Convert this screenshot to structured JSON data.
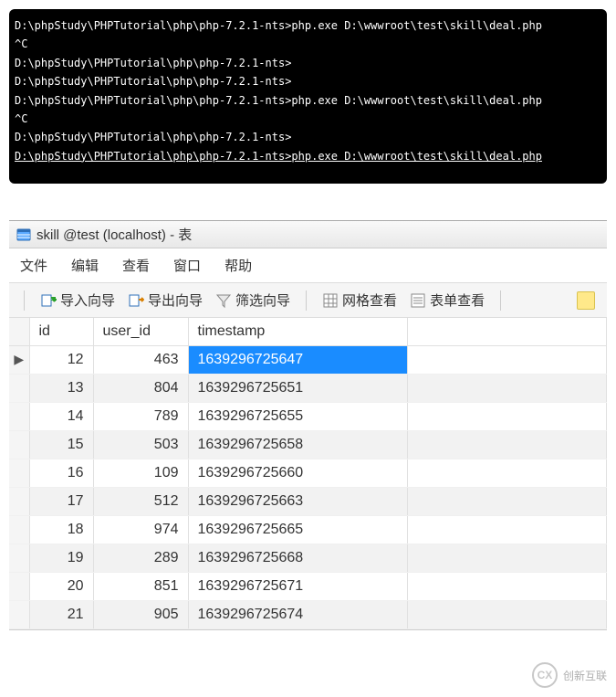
{
  "terminal": {
    "lines": [
      {
        "text": "D:\\phpStudy\\PHPTutorial\\php\\php-7.2.1-nts>php.exe D:\\wwwroot\\test\\skill\\deal.php",
        "underline": false
      },
      {
        "text": "^C",
        "underline": false
      },
      {
        "text": "D:\\phpStudy\\PHPTutorial\\php\\php-7.2.1-nts>",
        "underline": false
      },
      {
        "text": "D:\\phpStudy\\PHPTutorial\\php\\php-7.2.1-nts>",
        "underline": false
      },
      {
        "text": "D:\\phpStudy\\PHPTutorial\\php\\php-7.2.1-nts>php.exe D:\\wwwroot\\test\\skill\\deal.php",
        "underline": false
      },
      {
        "text": "^C",
        "underline": false
      },
      {
        "text": "D:\\phpStudy\\PHPTutorial\\php\\php-7.2.1-nts>",
        "underline": false
      },
      {
        "text": "D:\\phpStudy\\PHPTutorial\\php\\php-7.2.1-nts>php.exe D:\\wwwroot\\test\\skill\\deal.php",
        "underline": true
      }
    ]
  },
  "db": {
    "title": "skill @test (localhost) - 表",
    "menu": {
      "file": "文件",
      "edit": "编辑",
      "view": "查看",
      "window": "窗口",
      "help": "帮助"
    },
    "toolbar": {
      "import": "导入向导",
      "export": "导出向导",
      "filter": "筛选向导",
      "grid_view": "网格查看",
      "form_view": "表单查看"
    },
    "columns": {
      "id": "id",
      "user_id": "user_id",
      "timestamp": "timestamp"
    },
    "rows": [
      {
        "id": 12,
        "user_id": 463,
        "timestamp": "1639296725647",
        "selected": true,
        "current": true
      },
      {
        "id": 13,
        "user_id": 804,
        "timestamp": "1639296725651",
        "selected": false,
        "current": false
      },
      {
        "id": 14,
        "user_id": 789,
        "timestamp": "1639296725655",
        "selected": false,
        "current": false
      },
      {
        "id": 15,
        "user_id": 503,
        "timestamp": "1639296725658",
        "selected": false,
        "current": false
      },
      {
        "id": 16,
        "user_id": 109,
        "timestamp": "1639296725660",
        "selected": false,
        "current": false
      },
      {
        "id": 17,
        "user_id": 512,
        "timestamp": "1639296725663",
        "selected": false,
        "current": false
      },
      {
        "id": 18,
        "user_id": 974,
        "timestamp": "1639296725665",
        "selected": false,
        "current": false
      },
      {
        "id": 19,
        "user_id": 289,
        "timestamp": "1639296725668",
        "selected": false,
        "current": false
      },
      {
        "id": 20,
        "user_id": 851,
        "timestamp": "1639296725671",
        "selected": false,
        "current": false
      },
      {
        "id": 21,
        "user_id": 905,
        "timestamp": "1639296725674",
        "selected": false,
        "current": false
      }
    ]
  },
  "watermark": {
    "text": "创新互联"
  }
}
